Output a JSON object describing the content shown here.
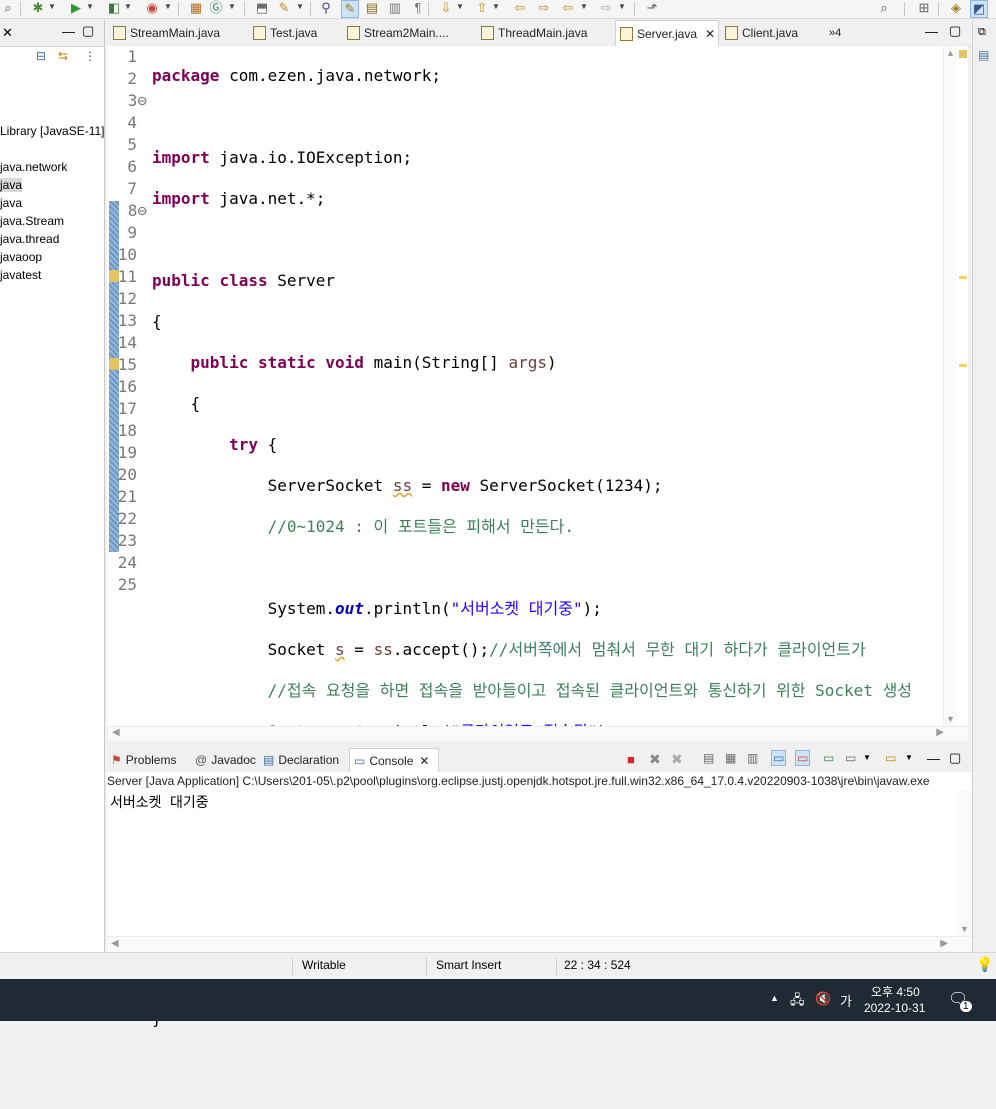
{
  "editor_tabs": [
    {
      "label": "StreamMain.java",
      "active": false
    },
    {
      "label": "Test.java",
      "active": false
    },
    {
      "label": "Stream2Main....",
      "active": false
    },
    {
      "label": "ThreadMain.java",
      "active": false
    },
    {
      "label": "Server.java",
      "active": true
    },
    {
      "label": "Client.java",
      "active": false
    }
  ],
  "tab_overflow": "»4",
  "package_explorer": {
    "items": [
      "Library [JavaSE-11]",
      "java.network",
      "java",
      "java",
      "java.Stream",
      "java.thread",
      "javaoop",
      "javatest"
    ]
  },
  "code": {
    "line_numbers": [
      "1",
      "2",
      "3",
      "4",
      "5",
      "6",
      "7",
      "8",
      "9",
      "10",
      "11",
      "12",
      "13",
      "14",
      "15",
      "16",
      "17",
      "18",
      "19",
      "20",
      "21",
      "22",
      "23",
      "24",
      "25"
    ]
  },
  "console": {
    "tabs": [
      "Problems",
      "Javadoc",
      "Declaration",
      "Console"
    ],
    "launch": "Server [Java Application] C:\\Users\\201-05\\.p2\\pool\\plugins\\org.eclipse.justj.openjdk.hotspot.jre.full.win32.x86_64_17.0.4.v20220903-1038\\jre\\bin\\javaw.exe",
    "output": "서버소켓 대기중"
  },
  "status": {
    "writable": "Writable",
    "insert_mode": "Smart Insert",
    "position": "22 : 34 : 524"
  },
  "taskbar": {
    "ime": "가",
    "time": "오후 4:50",
    "date": "2022-10-31",
    "notifications": "1"
  },
  "colors": {
    "keyword": "#7f0055",
    "string": "#2a00ff",
    "comment": "#3f7f5f",
    "field": "#0000c0",
    "current_line": "#e8f2fe"
  }
}
